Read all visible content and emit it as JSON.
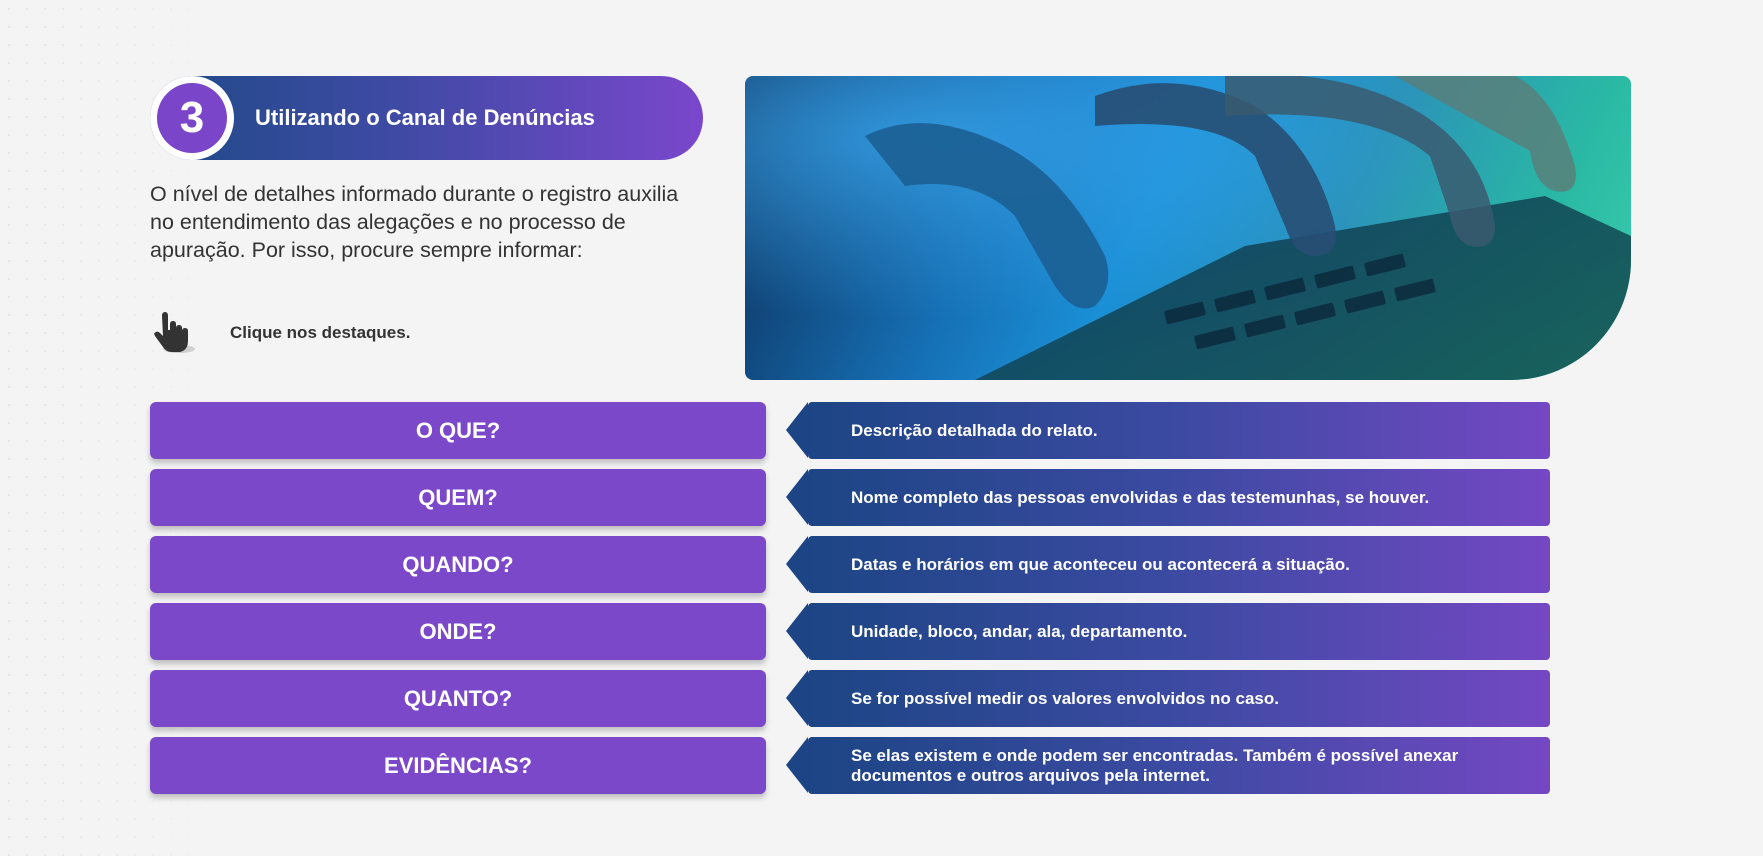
{
  "header": {
    "step_number": "3",
    "title": "Utilizando o Canal de Denúncias"
  },
  "intro": {
    "text": "O nível de detalhes informado durante o registro auxilia no entendimento das alegações e no processo de apuração. Por isso, procure sempre informar:"
  },
  "hint": {
    "icon": "pointing-hand-icon",
    "text": "Clique nos destaques."
  },
  "colors": {
    "purple": "#7c48ca",
    "navy": "#1d4585",
    "background": "#f4f4f4"
  },
  "items": [
    {
      "question": "O QUE?",
      "answer": "Descrição detalhada do relato."
    },
    {
      "question": "QUEM?",
      "answer": "Nome completo das pessoas envolvidas e das testemunhas, se houver."
    },
    {
      "question": "QUANDO?",
      "answer": "Datas e horários em que aconteceu ou acontecerá a situação."
    },
    {
      "question": "ONDE?",
      "answer": "Unidade, bloco, andar, ala, departamento."
    },
    {
      "question": "QUANTO?",
      "answer": "Se for possível medir os valores envolvidos no caso."
    },
    {
      "question": "EVIDÊNCIAS?",
      "answer": "Se elas existem e onde podem ser encontradas. Também é possível anexar documentos e outros arquivos pela internet."
    }
  ]
}
